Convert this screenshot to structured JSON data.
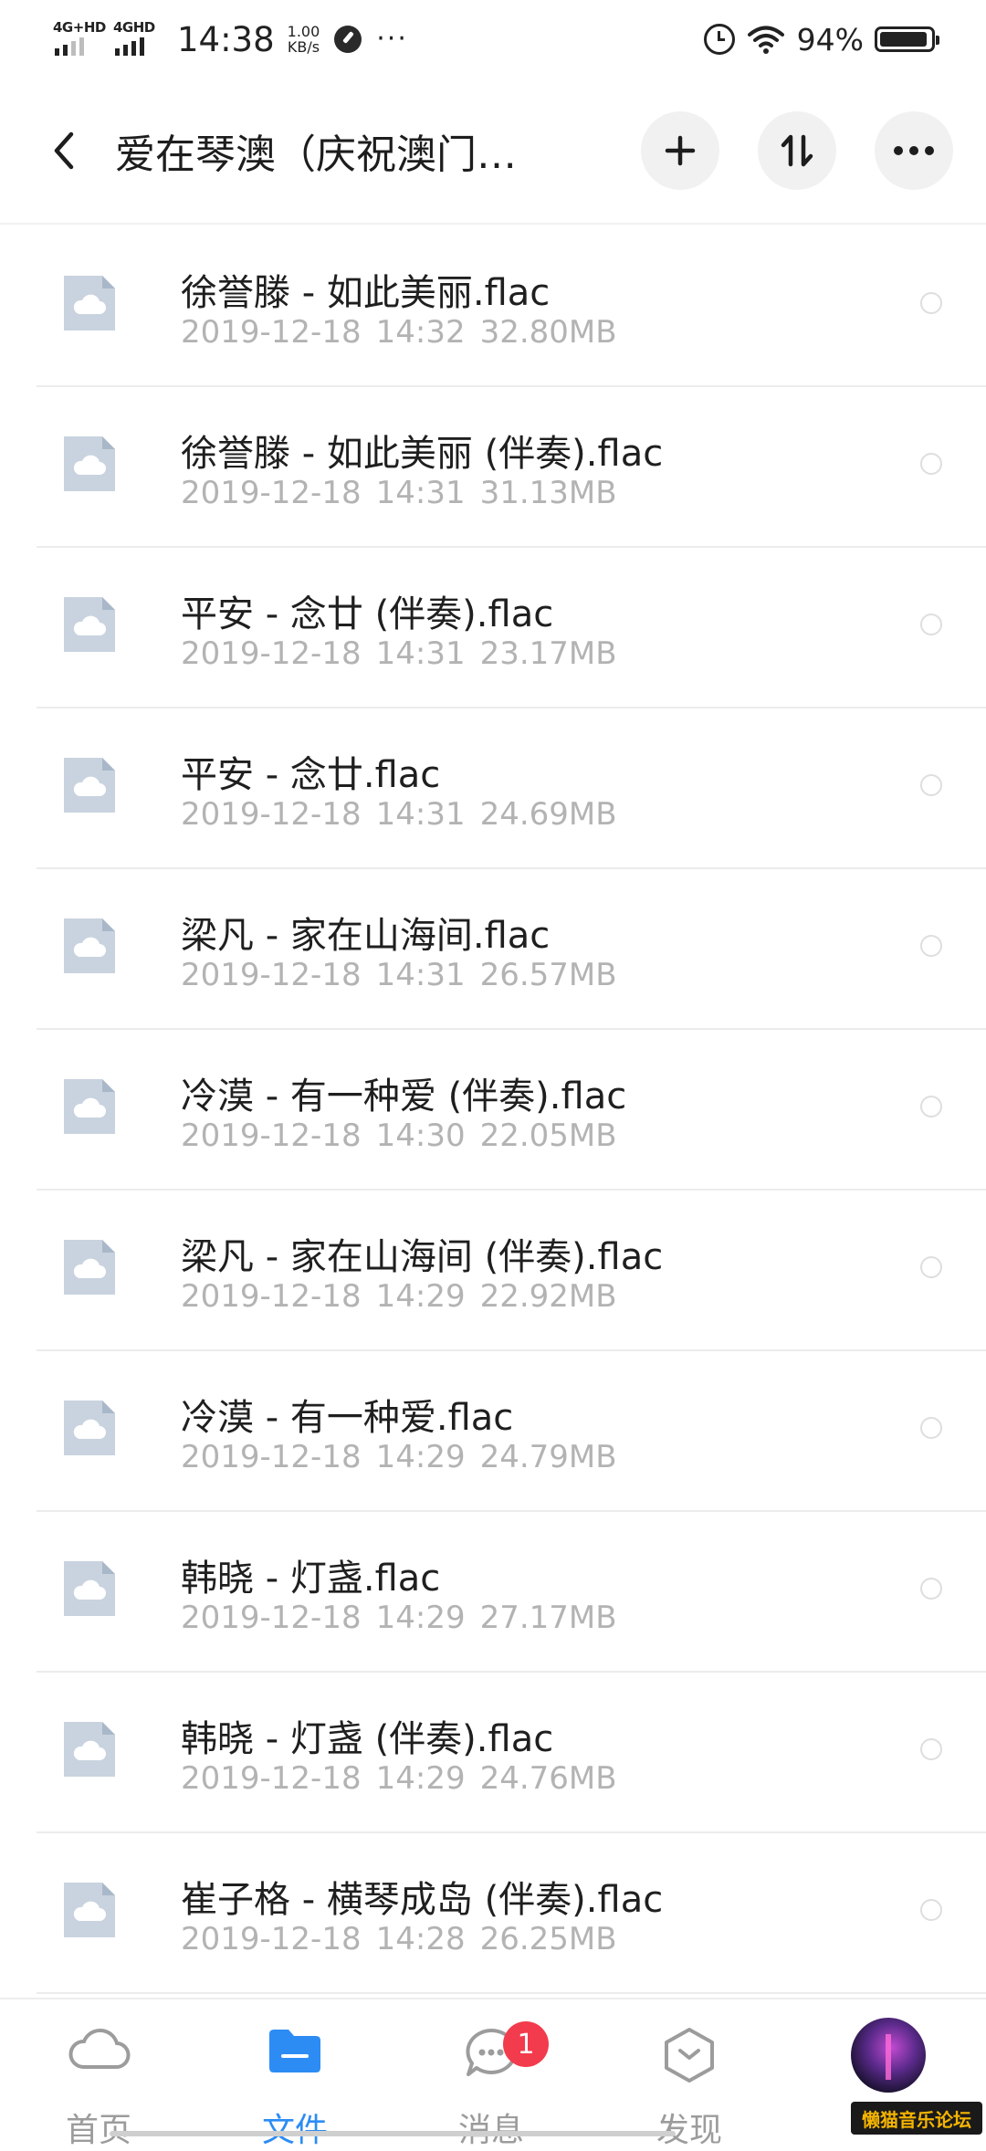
{
  "status_bar": {
    "net1": "4G+HD",
    "net2": "4GHD",
    "time": "14:38",
    "speed_value": "1.00",
    "speed_unit": "KB/s",
    "more": "···",
    "battery": "94%",
    "battery_level": 0.94
  },
  "header": {
    "title": "爱在琴澳（庆祝澳门…",
    "icons": [
      "back-icon",
      "plus-icon",
      "sort-icon",
      "more-icon"
    ]
  },
  "files": [
    {
      "name": "徐誉滕 - 如此美丽.flac",
      "date": "2019-12-18",
      "time": "14:32",
      "size": "32.80MB"
    },
    {
      "name": "徐誉滕 - 如此美丽 (伴奏).flac",
      "date": "2019-12-18",
      "time": "14:31",
      "size": "31.13MB"
    },
    {
      "name": "平安 - 念廿 (伴奏).flac",
      "date": "2019-12-18",
      "time": "14:31",
      "size": "23.17MB"
    },
    {
      "name": "平安 - 念廿.flac",
      "date": "2019-12-18",
      "time": "14:31",
      "size": "24.69MB"
    },
    {
      "name": "梁凡 - 家在山海间.flac",
      "date": "2019-12-18",
      "time": "14:31",
      "size": "26.57MB"
    },
    {
      "name": "冷漠 - 有一种爱 (伴奏).flac",
      "date": "2019-12-18",
      "time": "14:30",
      "size": "22.05MB"
    },
    {
      "name": "梁凡 - 家在山海间 (伴奏).flac",
      "date": "2019-12-18",
      "time": "14:29",
      "size": "22.92MB"
    },
    {
      "name": "冷漠 - 有一种爱.flac",
      "date": "2019-12-18",
      "time": "14:29",
      "size": "24.79MB"
    },
    {
      "name": "韩晓 - 灯盏.flac",
      "date": "2019-12-18",
      "time": "14:29",
      "size": "27.17MB"
    },
    {
      "name": "韩晓 - 灯盏 (伴奏).flac",
      "date": "2019-12-18",
      "time": "14:29",
      "size": "24.76MB"
    },
    {
      "name": "崔子格 - 横琴成岛 (伴奏).flac",
      "date": "2019-12-18",
      "time": "14:28",
      "size": "26.25MB"
    }
  ],
  "bottom_nav": {
    "items": [
      {
        "label": "首页",
        "icon": "cloud-icon"
      },
      {
        "label": "文件",
        "icon": "folder-icon",
        "active": true
      },
      {
        "label": "消息",
        "icon": "chat-icon",
        "badge": "1"
      },
      {
        "label": "发现",
        "icon": "discover-icon"
      }
    ],
    "active_color": "#2c8cf4",
    "badge_color": "#f23b4c"
  },
  "watermark": "懒猫音乐论坛"
}
